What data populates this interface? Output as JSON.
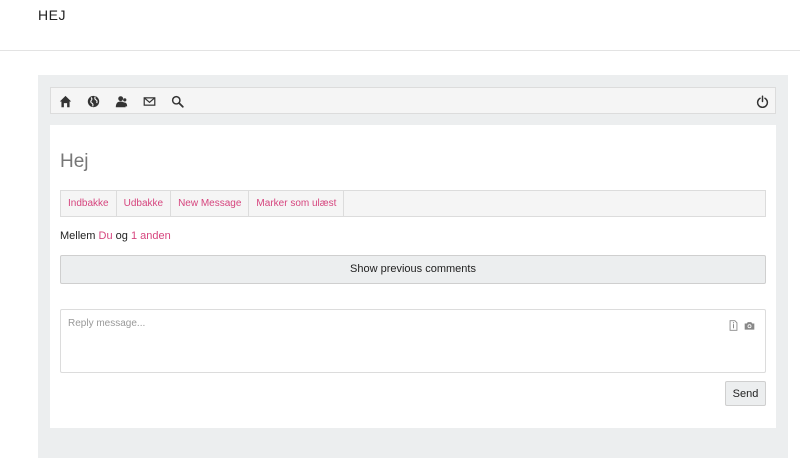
{
  "site": {
    "title": "HEJ"
  },
  "toolbar": {
    "icons": [
      "home-icon",
      "globe-icon",
      "users-icon",
      "envelope-icon",
      "search-icon",
      "power-icon"
    ]
  },
  "page": {
    "title": "Hej"
  },
  "tabs": [
    {
      "label": "Indbakke"
    },
    {
      "label": "Udbakke"
    },
    {
      "label": "New Message"
    },
    {
      "label": "Marker som ulæst"
    }
  ],
  "participants": {
    "prefix": "Mellem",
    "first": "Du",
    "joiner": "og",
    "others": "1 anden"
  },
  "show_previous_label": "Show previous comments",
  "reply": {
    "placeholder": "Reply message...",
    "value": "",
    "icons": [
      "file-icon",
      "camera-icon"
    ]
  },
  "send_label": "Send",
  "colors": {
    "accent": "#d6457e",
    "panel": "#eceeef"
  }
}
